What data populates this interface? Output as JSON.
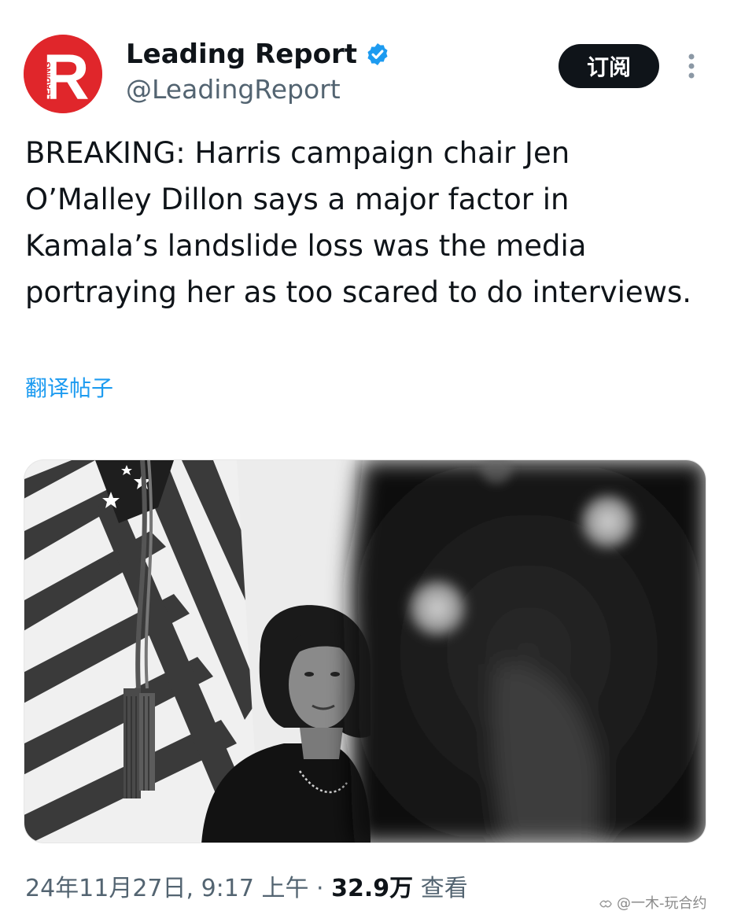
{
  "author": {
    "logo_letter": "R",
    "logo_text": "LEADING",
    "display_name": "Leading Report",
    "handle": "@LeadingReport",
    "verified_icon": "verified-badge-icon",
    "brand_color": "#e0262b",
    "verified_color": "#1d9bf0"
  },
  "actions": {
    "subscribe_label": "订阅",
    "more_icon": "more-vertical-icon"
  },
  "post": {
    "text": "BREAKING: Harris campaign chair Jen O’Malley Dillon says a major factor in Kamala’s landslide loss was the media portraying her as too scared to do interviews.",
    "translate_label": "翻译帖子"
  },
  "meta": {
    "timestamp": "24年11月27日, 9:17 上午",
    "separator": "·",
    "views_count": "32.9万",
    "views_label": "查看"
  },
  "watermark": {
    "text": "@一木-玩合约"
  }
}
